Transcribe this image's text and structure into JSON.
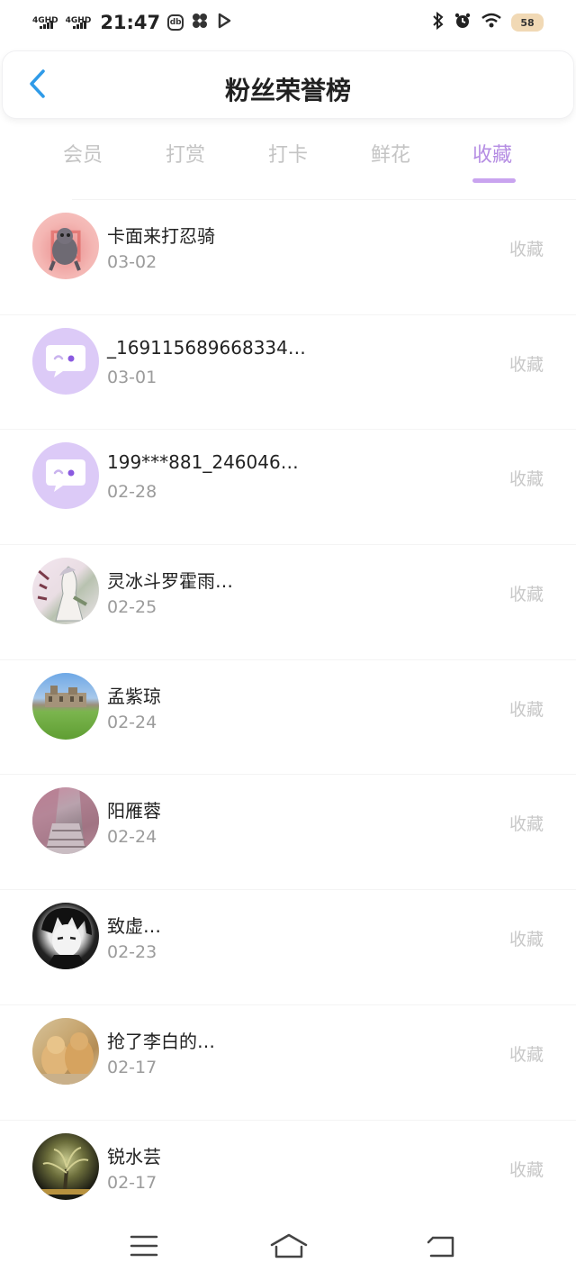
{
  "status_bar": {
    "sim1": "4GHD",
    "sim2": "4GHD",
    "time": "21:47",
    "app_icon_text": "db",
    "battery": "58",
    "icons": [
      "bluetooth-icon",
      "alarm-icon",
      "wifi-icon",
      "battery-icon"
    ]
  },
  "header": {
    "title": "粉丝荣誉榜",
    "back_icon": "chevron-left-icon"
  },
  "tabs": [
    {
      "label": "会员",
      "active": false
    },
    {
      "label": "打赏",
      "active": false
    },
    {
      "label": "打卡",
      "active": false
    },
    {
      "label": "鲜花",
      "active": false
    },
    {
      "label": "收藏",
      "active": true
    }
  ],
  "colors": {
    "accent": "#b58de3",
    "tab_inactive": "#c4c4c4",
    "back_icon": "#2f9be8",
    "default_avatar": "#dccaf7"
  },
  "list": [
    {
      "name": "卡面来打忍骑",
      "date": "03-02",
      "action": "收藏",
      "avatar": "photo"
    },
    {
      "name": "_169115689668334…",
      "date": "03-01",
      "action": "收藏",
      "avatar": "default-chat-avatar"
    },
    {
      "name": "199***881_246046…",
      "date": "02-28",
      "action": "收藏",
      "avatar": "default-chat-avatar"
    },
    {
      "name": "灵冰斗罗霍雨…",
      "date": "02-25",
      "action": "收藏",
      "avatar": "photo"
    },
    {
      "name": "孟紫琼",
      "date": "02-24",
      "action": "收藏",
      "avatar": "photo"
    },
    {
      "name": "阳雁蓉",
      "date": "02-24",
      "action": "收藏",
      "avatar": "photo"
    },
    {
      "name": "致虚…",
      "date": "02-23",
      "action": "收藏",
      "avatar": "photo"
    },
    {
      "name": "抢了李白的…",
      "date": "02-17",
      "action": "收藏",
      "avatar": "photo"
    },
    {
      "name": "锐水芸",
      "date": "02-17",
      "action": "收藏",
      "avatar": "photo"
    }
  ],
  "bottom_nav": {
    "icons": [
      "menu-icon",
      "home-icon",
      "back-icon"
    ]
  }
}
